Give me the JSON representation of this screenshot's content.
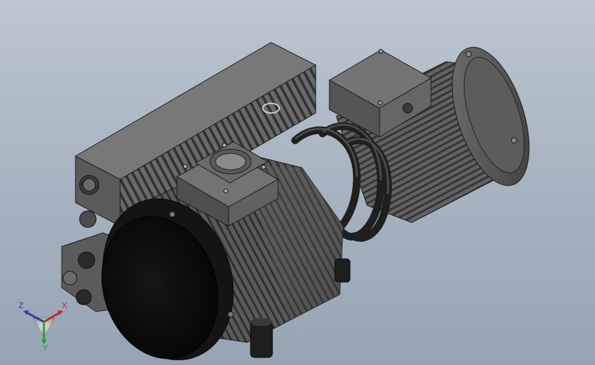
{
  "viewport": {
    "background_top": "#bcc6d2",
    "background_bottom": "#97a4b4"
  },
  "model": {
    "body_color": "#5f5f5f",
    "dark_color": "#2b2b2b",
    "edge_color": "#1a1a1a",
    "cap_color": "#0d0d0d"
  },
  "triad": {
    "x_label": "X",
    "y_label": "Y",
    "z_label": "Z",
    "x_color": "#c0282d",
    "y_color": "#2f9a3a",
    "z_color": "#2a3fa8"
  }
}
